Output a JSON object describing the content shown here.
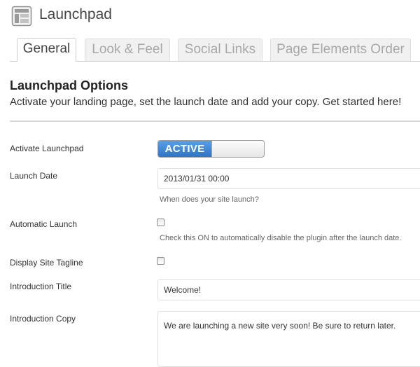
{
  "page": {
    "title": "Launchpad",
    "icon": "layout-icon"
  },
  "tabs": [
    {
      "label": "General",
      "active": true
    },
    {
      "label": "Look & Feel",
      "active": false
    },
    {
      "label": "Social Links",
      "active": false
    },
    {
      "label": "Page Elements Order",
      "active": false
    }
  ],
  "section": {
    "title": "Launchpad Options",
    "description": "Activate your landing page, set the launch date and add your copy. Get started here!"
  },
  "fields": {
    "activate": {
      "label": "Activate Launchpad",
      "toggle_text": "ACTIVE",
      "on": true
    },
    "launch_date": {
      "label": "Launch Date",
      "value": "2013/01/31 00:00",
      "help": "When does your site launch?"
    },
    "auto_launch": {
      "label": "Automatic Launch",
      "checked": false,
      "help": "Check this ON to automatically disable the plugin after the launch date."
    },
    "tagline": {
      "label": "Display Site Tagline",
      "checked": false
    },
    "intro_title": {
      "label": "Introduction Title",
      "value": "Welcome!"
    },
    "intro_copy": {
      "label": "Introduction Copy",
      "value": "We are launching a new site very soon! Be sure to return later."
    }
  },
  "colors": {
    "toggle_active": "#3a80d2",
    "tab_active_text": "#464646",
    "tab_inactive_text": "#a8a8a8"
  }
}
